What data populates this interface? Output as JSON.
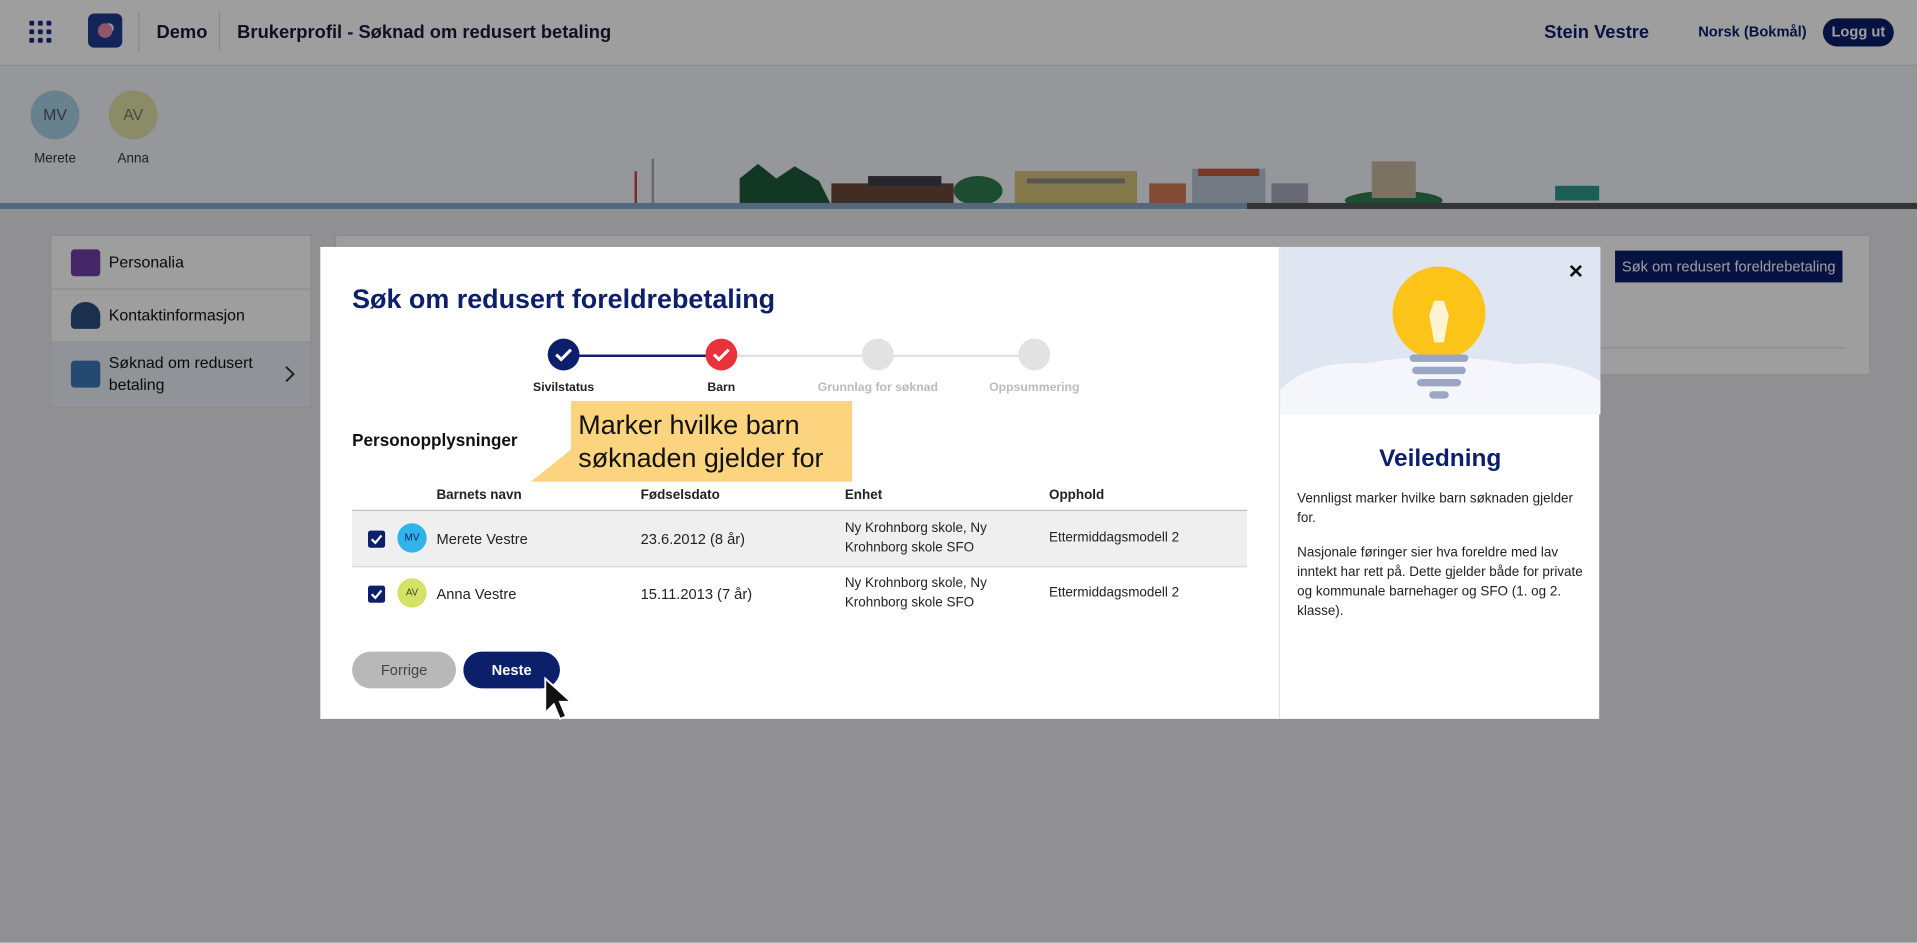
{
  "topbar": {
    "app_name": "Demo",
    "page_title": "Brukerprofil - Søknad om redusert betaling",
    "user_name": "Stein Vestre",
    "language": "Norsk (Bokmål)",
    "logout_label": "Logg ut"
  },
  "children_header": [
    {
      "initials": "MV",
      "name": "Merete",
      "color": "#a9d1e6"
    },
    {
      "initials": "AV",
      "name": "Anna",
      "color": "#dde3a6"
    }
  ],
  "sidebar": {
    "items": [
      {
        "label": "Personalia",
        "icon": "id-card-icon"
      },
      {
        "label": "Kontaktinformasjon",
        "icon": "contact-person-icon"
      },
      {
        "label": "Søknad om redusert betaling",
        "icon": "application-form-icon",
        "active": true
      }
    ]
  },
  "apply_button_label": "Søk om redusert foreldrebetaling",
  "modal": {
    "title": "Søk om redusert foreldrebetaling",
    "steps": [
      {
        "label": "Sivilstatus",
        "state": "done"
      },
      {
        "label": "Barn",
        "state": "current"
      },
      {
        "label": "Grunnlag for søknad",
        "state": "todo"
      },
      {
        "label": "Oppsummering",
        "state": "todo"
      }
    ],
    "section_title": "Personopplysninger",
    "tooltip": "Marker hvilke barn søknaden gjelder for",
    "table": {
      "headers": [
        "Barnets navn",
        "Fødselsdato",
        "Enhet",
        "Opphold"
      ],
      "rows": [
        {
          "checked": true,
          "initials": "MV",
          "avatar_color": "#2fb3e8",
          "name": "Merete Vestre",
          "birthdate": "23.6.2012 (8 år)",
          "unit": "Ny Krohnborg skole, Ny Krohnborg skole SFO",
          "stay": "Ettermiddagsmodell 2"
        },
        {
          "checked": true,
          "initials": "AV",
          "avatar_color": "#d4e26a",
          "name": "Anna Vestre",
          "birthdate": "15.11.2013 (7 år)",
          "unit": "Ny Krohnborg skole, Ny Krohnborg skole SFO",
          "stay": "Ettermiddagsmodell 2"
        }
      ]
    },
    "prev_label": "Forrige",
    "next_label": "Neste",
    "close_label": "×",
    "guidance": {
      "title": "Veiledning",
      "paragraphs": [
        "Vennligst marker hvilke barn søknaden gjelder for.",
        "Nasjonale føringer sier hva foreldre med lav inntekt har rett på. Dette gjelder både for private og kommunale barnehager og SFO (1. og 2. klasse)."
      ]
    }
  },
  "colors": {
    "primary": "#0b1f6b",
    "step_done": "#0b1f6b",
    "step_current": "#e8333c",
    "step_todo": "#e2e2e2",
    "tooltip": "#fcd47f"
  }
}
